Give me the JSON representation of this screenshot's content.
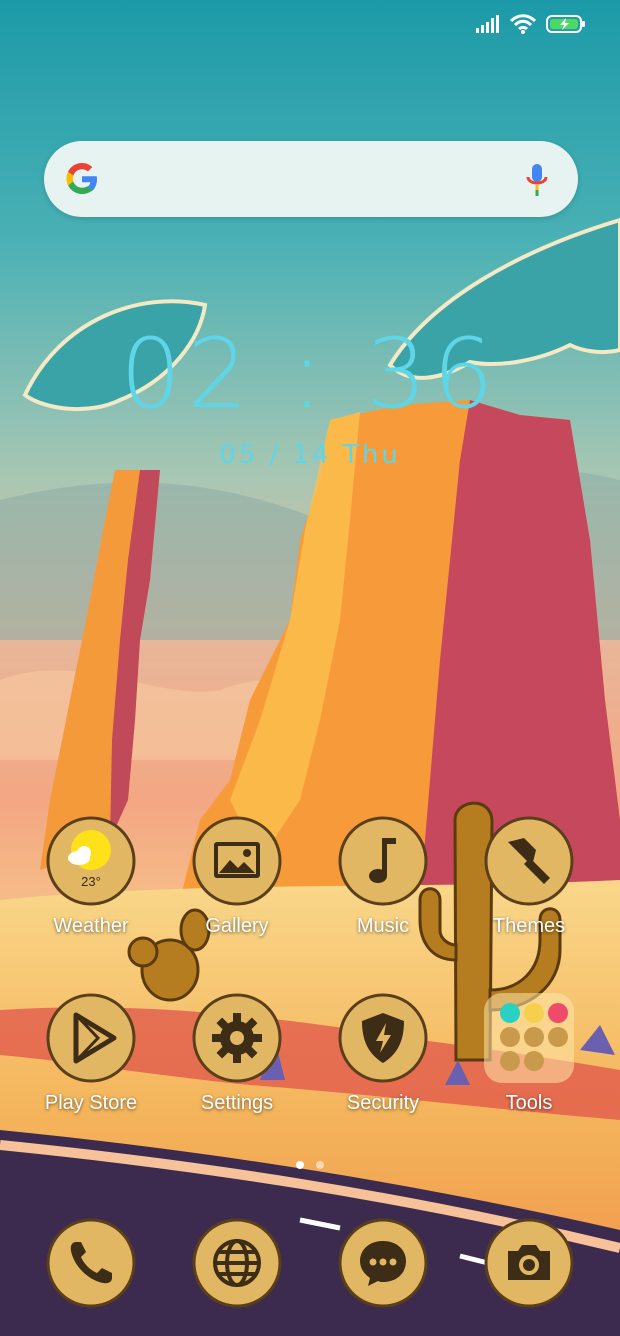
{
  "clock": {
    "time": "02 : 36",
    "date": "05 / 14   Thu"
  },
  "apps": [
    {
      "label": "Weather",
      "icon": "weather-icon",
      "temp": "23°"
    },
    {
      "label": "Gallery",
      "icon": "gallery-icon"
    },
    {
      "label": "Music",
      "icon": "music-note-icon"
    },
    {
      "label": "Themes",
      "icon": "paint-brush-icon"
    },
    {
      "label": "Play Store",
      "icon": "play-store-icon"
    },
    {
      "label": "Settings",
      "icon": "gear-icon"
    },
    {
      "label": "Security",
      "icon": "shield-bolt-icon"
    },
    {
      "label": "Tools",
      "icon": "folder-icon"
    }
  ],
  "dock": [
    {
      "icon": "phone-icon"
    },
    {
      "icon": "globe-icon"
    },
    {
      "icon": "chat-bubble-icon"
    },
    {
      "icon": "camera-icon"
    }
  ],
  "pages": {
    "count": 2,
    "active": 0
  },
  "colors": {
    "clock": "#5fd6e8",
    "icon_bg": "#e2b764",
    "icon_glyph": "#3d2c16"
  }
}
